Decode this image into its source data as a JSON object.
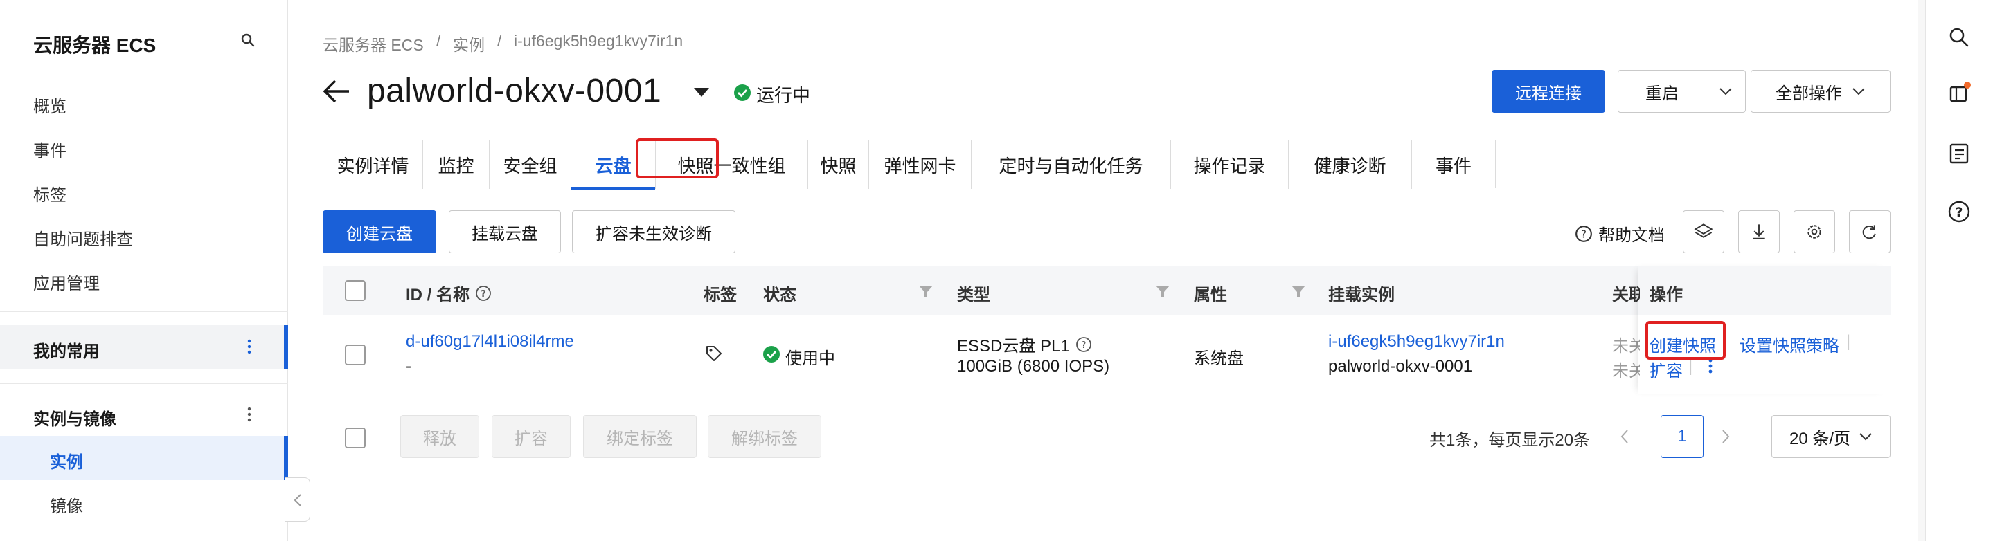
{
  "sidebar": {
    "title": "云服务器 ECS",
    "items": [
      "概览",
      "事件",
      "标签",
      "自助问题排查",
      "应用管理"
    ],
    "favorites_label": "我的常用",
    "group_label": "实例与镜像",
    "sub_items": [
      "实例",
      "镜像"
    ]
  },
  "breadcrumb": [
    "云服务器 ECS",
    "实例",
    "i-uf6egk5h9eg1kvy7ir1n"
  ],
  "breadcrumb_sep": "/",
  "header": {
    "title": "palworld-okxv-0001",
    "status": "运行中",
    "buttons": {
      "remote": "远程连接",
      "restart": "重启",
      "all_ops": "全部操作"
    }
  },
  "tabs": [
    "实例详情",
    "监控",
    "安全组",
    "云盘",
    "快照一致性组",
    "快照",
    "弹性网卡",
    "定时与自动化任务",
    "操作记录",
    "健康诊断",
    "事件"
  ],
  "active_tab": "云盘",
  "toolbar": {
    "create_disk": "创建云盘",
    "attach_disk": "挂载云盘",
    "expand_diag": "扩容未生效诊断",
    "help": "帮助文档"
  },
  "table": {
    "headers": {
      "id": "ID / 名称",
      "tag": "标签",
      "status": "状态",
      "type": "类型",
      "attr": "属性",
      "instance": "挂载实例",
      "related": "关联",
      "ops": "操作"
    },
    "row": {
      "id": "d-uf60g17l4l1i08il4rme",
      "name": "-",
      "status": "使用中",
      "type_line1": "ESSD云盘 PL1",
      "type_line2": "100GiB (6800 IOPS)",
      "attr": "系统盘",
      "instance_id": "i-uf6egk5h9eg1kvy7ir1n",
      "instance_name": "palworld-okxv-0001",
      "related_1": "未关",
      "related_2": "未关",
      "op_snapshot": "创建快照",
      "op_policy": "设置快照策略",
      "op_expand": "扩容"
    }
  },
  "footer": {
    "release": "释放",
    "expand": "扩容",
    "bind_tag": "绑定标签",
    "unbind_tag": "解绑标签",
    "total": "共1条，每页显示20条",
    "page": "1",
    "page_size": "20 条/页"
  },
  "colors": {
    "primary": "#1a60d8",
    "success": "#1ba14a",
    "highlight": "#e02020"
  }
}
